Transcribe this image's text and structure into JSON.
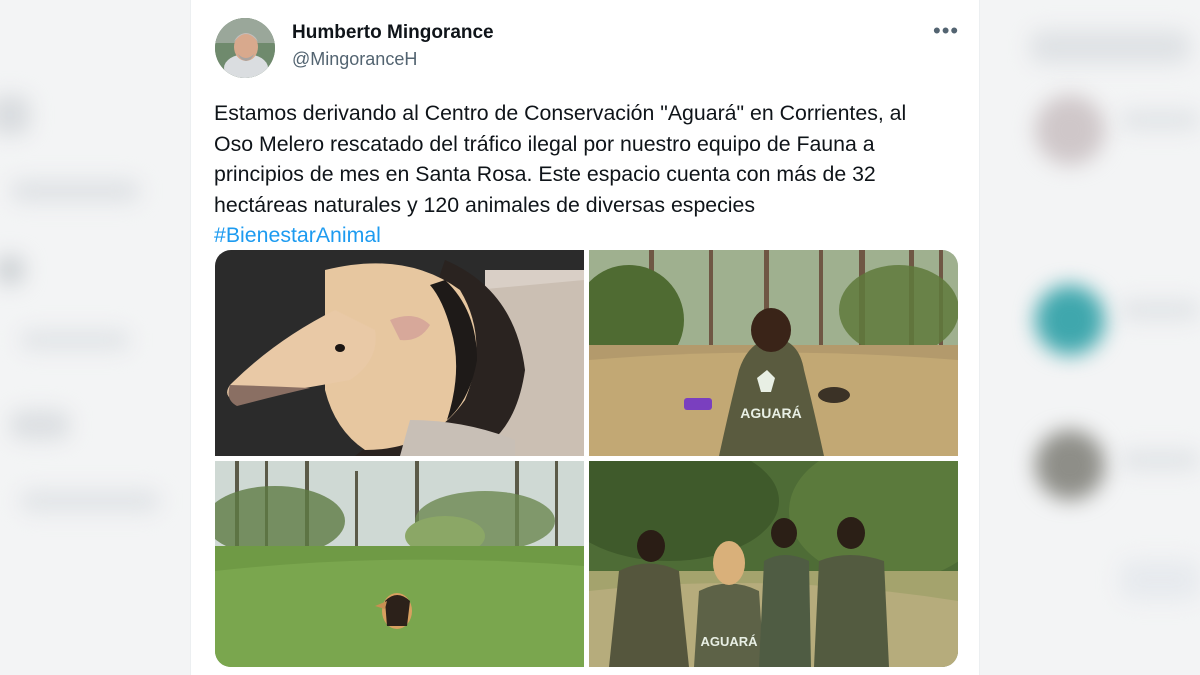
{
  "tweet": {
    "author_name": "Humberto Mingorance",
    "author_handle": "@MingoranceH",
    "more_label": "•••",
    "text_lines": [
      "Estamos derivando al Centro de Conservación \"Aguará\" en Corrientes, al",
      "Oso Melero rescatado del tráfico ilegal por nuestro equipo de Fauna a",
      "principios de mes en Santa Rosa. Este espacio cuenta con más de 32",
      "hectáreas naturales y 120 animales de diversas especies"
    ],
    "hashtag": "#BienestarAnimal",
    "photos": [
      {
        "subject": "anteater-closeup"
      },
      {
        "subject": "keeper-in-forest-clearing",
        "shirt_text": "AGUARÁ"
      },
      {
        "subject": "anteater-on-lawn"
      },
      {
        "subject": "team-walking-in-forest",
        "shirt_text": "AGUARÁ"
      }
    ]
  },
  "colors": {
    "text": "#0f1419",
    "secondary": "#536471",
    "link": "#1d9bf0",
    "background": "#ffffff"
  },
  "icons": {
    "more": "more-horizontal-icon"
  }
}
